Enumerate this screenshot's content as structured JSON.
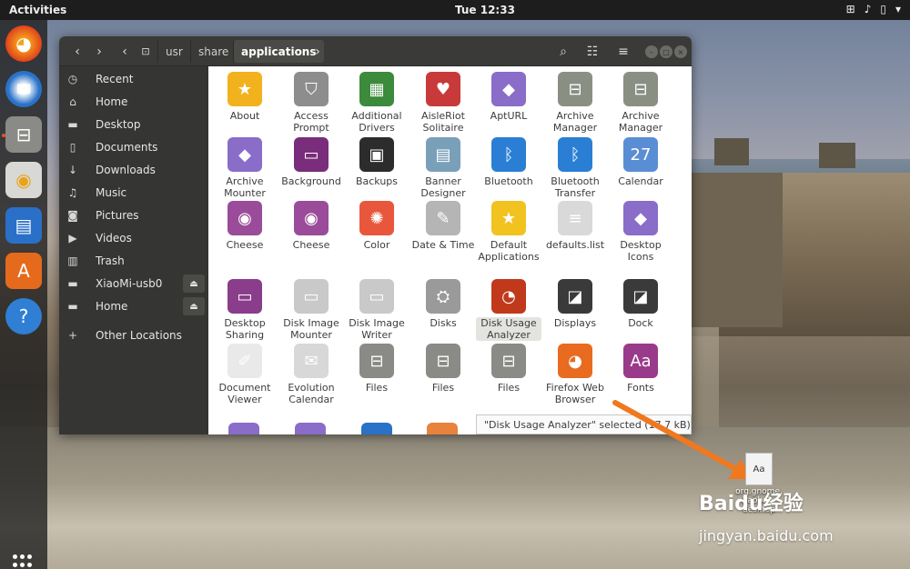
{
  "topbar": {
    "activities": "Activities",
    "clock": "Tue 12:33",
    "tray": [
      "network-icon",
      "volume-icon",
      "battery-icon",
      "menu-icon"
    ]
  },
  "dock": [
    "Firefox",
    "Thunderbird",
    "Files",
    "Rhythmbox",
    "LibreOffice Writer",
    "Ubuntu Software",
    "Help"
  ],
  "breadcrumb": {
    "items": [
      "usr",
      "share",
      "applications"
    ]
  },
  "sidebar": [
    {
      "label": "Recent",
      "icon": "clock-icon"
    },
    {
      "label": "Home",
      "icon": "home-icon"
    },
    {
      "label": "Desktop",
      "icon": "desktop-icon"
    },
    {
      "label": "Documents",
      "icon": "document-icon"
    },
    {
      "label": "Downloads",
      "icon": "download-icon"
    },
    {
      "label": "Music",
      "icon": "music-icon"
    },
    {
      "label": "Pictures",
      "icon": "camera-icon"
    },
    {
      "label": "Videos",
      "icon": "video-icon"
    },
    {
      "label": "Trash",
      "icon": "trash-icon"
    },
    {
      "label": "XiaoMi-usb0",
      "icon": "drive-icon"
    },
    {
      "label": "Home",
      "icon": "drive-icon"
    },
    {
      "label": "Other Locations",
      "icon": "plus-icon"
    }
  ],
  "apps": [
    {
      "name": "About",
      "color": "#f2b21e",
      "glyph": "★"
    },
    {
      "name": "Access Prompt",
      "color": "#8d8d8d",
      "glyph": "⛉"
    },
    {
      "name": "Additional Drivers",
      "color": "#3c8a3c",
      "glyph": "▦"
    },
    {
      "name": "AisleRiot Solitaire",
      "color": "#c83a3a",
      "glyph": "♥"
    },
    {
      "name": "AptURL",
      "color": "#8a6cc9",
      "glyph": "◆"
    },
    {
      "name": "Archive Manager",
      "color": "#8a8f84",
      "glyph": "⊟"
    },
    {
      "name": "Archive Manager",
      "color": "#8a8f84",
      "glyph": "⊟"
    },
    {
      "name": "Archive Mounter",
      "color": "#8a6cc9",
      "glyph": "◆"
    },
    {
      "name": "Background",
      "color": "#7a2d7a",
      "glyph": "▭"
    },
    {
      "name": "Backups",
      "color": "#2c2c2c",
      "glyph": "▣"
    },
    {
      "name": "Banner Designer",
      "color": "#7a9fb8",
      "glyph": "▤"
    },
    {
      "name": "Bluetooth",
      "color": "#2a7fd4",
      "glyph": "ᛒ"
    },
    {
      "name": "Bluetooth Transfer",
      "color": "#2a7fd4",
      "glyph": "ᛒ"
    },
    {
      "name": "Calendar",
      "color": "#5a8ed4",
      "glyph": "27"
    },
    {
      "name": "Cheese",
      "color": "#9a4c9a",
      "glyph": "◉"
    },
    {
      "name": "Cheese",
      "color": "#9a4c9a",
      "glyph": "◉"
    },
    {
      "name": "Color",
      "color": "#e8573c",
      "glyph": "✺"
    },
    {
      "name": "Date & Time",
      "color": "#b5b5b5",
      "glyph": "✎"
    },
    {
      "name": "Default Applications",
      "color": "#f2c21e",
      "glyph": "★"
    },
    {
      "name": "defaults.list",
      "color": "#d9d9d9",
      "glyph": "≡"
    },
    {
      "name": "Desktop Icons",
      "color": "#8a6cc9",
      "glyph": "◆"
    },
    {
      "name": "Desktop Sharing",
      "color": "#8a3d8a",
      "glyph": "▭"
    },
    {
      "name": "Disk Image Mounter",
      "color": "#c9c9c9",
      "glyph": "▭"
    },
    {
      "name": "Disk Image Writer",
      "color": "#c9c9c9",
      "glyph": "▭"
    },
    {
      "name": "Disks",
      "color": "#9a9a9a",
      "glyph": "⛭"
    },
    {
      "name": "Disk Usage Analyzer",
      "color": "#c0391b",
      "glyph": "◔"
    },
    {
      "name": "Displays",
      "color": "#3a3a3a",
      "glyph": "◪"
    },
    {
      "name": "Dock",
      "color": "#3a3a3a",
      "glyph": "◪"
    },
    {
      "name": "Document Viewer",
      "color": "#e9e9e9",
      "glyph": "✐"
    },
    {
      "name": "Evolution Calendar",
      "color": "#d8d8d8",
      "glyph": "✉"
    },
    {
      "name": "Files",
      "color": "#8a8a86",
      "glyph": "⊟"
    },
    {
      "name": "Files",
      "color": "#8a8a86",
      "glyph": "⊟"
    },
    {
      "name": "Files",
      "color": "#8a8a86",
      "glyph": "⊟"
    },
    {
      "name": "Firefox Web Browser",
      "color": "#e86b1f",
      "glyph": "◕"
    },
    {
      "name": "Fonts",
      "color": "#9a3a8a",
      "glyph": "Aa"
    }
  ],
  "status": "\"Disk Usage Analyzer\" selected (17.7 kB)",
  "desktop_file": {
    "badge": "Aa",
    "caption": "org.gnome. baobab. desktop"
  },
  "watermark": {
    "brand": "Baidu经验",
    "url": "jingyan.baidu.com"
  }
}
